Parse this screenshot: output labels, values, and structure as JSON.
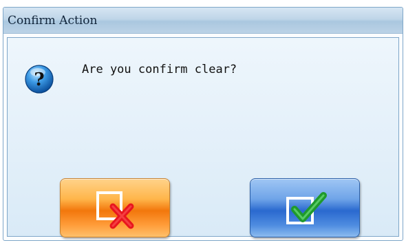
{
  "dialog": {
    "title": "Confirm Action",
    "message": "Are you confirm clear?",
    "icon": "question-icon",
    "buttons": {
      "cancel": {
        "icon": "box-cross-icon",
        "accent": "#f2770c"
      },
      "confirm": {
        "icon": "box-check-icon",
        "accent": "#2a69cf"
      }
    }
  }
}
